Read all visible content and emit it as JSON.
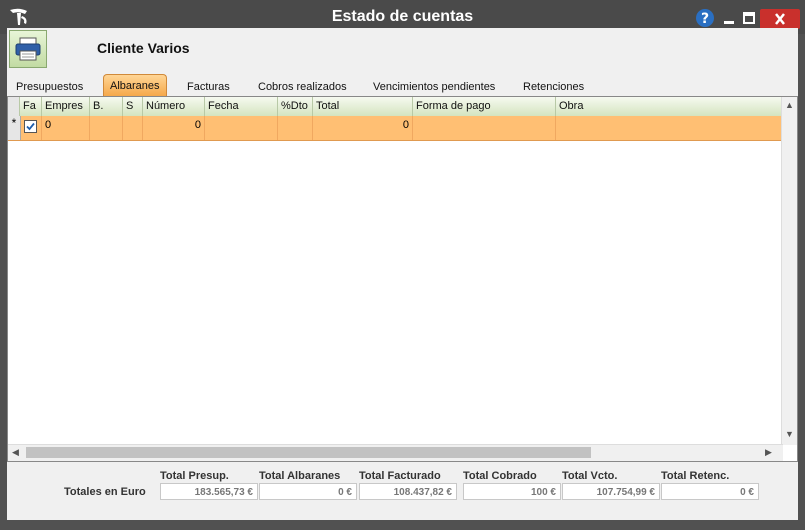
{
  "window": {
    "title": "Estado de cuentas",
    "help_label": "?",
    "min_label": "–",
    "max_label": "□",
    "close_label": "✕"
  },
  "client": {
    "name": "Cliente Varios"
  },
  "tabs": [
    {
      "label": "Presupuestos"
    },
    {
      "label": "Albaranes",
      "active": true
    },
    {
      "label": "Facturas"
    },
    {
      "label": "Cobros realizados"
    },
    {
      "label": "Vencimientos pendientes"
    },
    {
      "label": "Retenciones"
    }
  ],
  "grid": {
    "columns": [
      "Fa",
      "Empres",
      "B.",
      "S",
      "Número",
      "Fecha",
      "%Dto",
      "Total",
      "Forma de pago",
      "Obra"
    ],
    "row_marker": "*",
    "rows": [
      {
        "checked": true,
        "empresa": "0",
        "b": "",
        "s": "",
        "numero": "0",
        "fecha": "",
        "dto": "",
        "total": "0",
        "forma_pago": "",
        "obra": ""
      }
    ]
  },
  "totals": {
    "label": "Totales en Euro",
    "headers": [
      "Total Presup.",
      "Total Albaranes",
      "Total Facturado",
      "Total Cobrado",
      "Total Vcto.",
      "Total Retenc."
    ],
    "values": [
      "183.565,73 €",
      "0 €",
      "108.437,82 €",
      "100 €",
      "107.754,99 €",
      "0 €"
    ]
  },
  "colors": {
    "accent_row": "#ffbf73",
    "tab_active": "#f5a94a",
    "header_green": "#d4e4bf"
  }
}
